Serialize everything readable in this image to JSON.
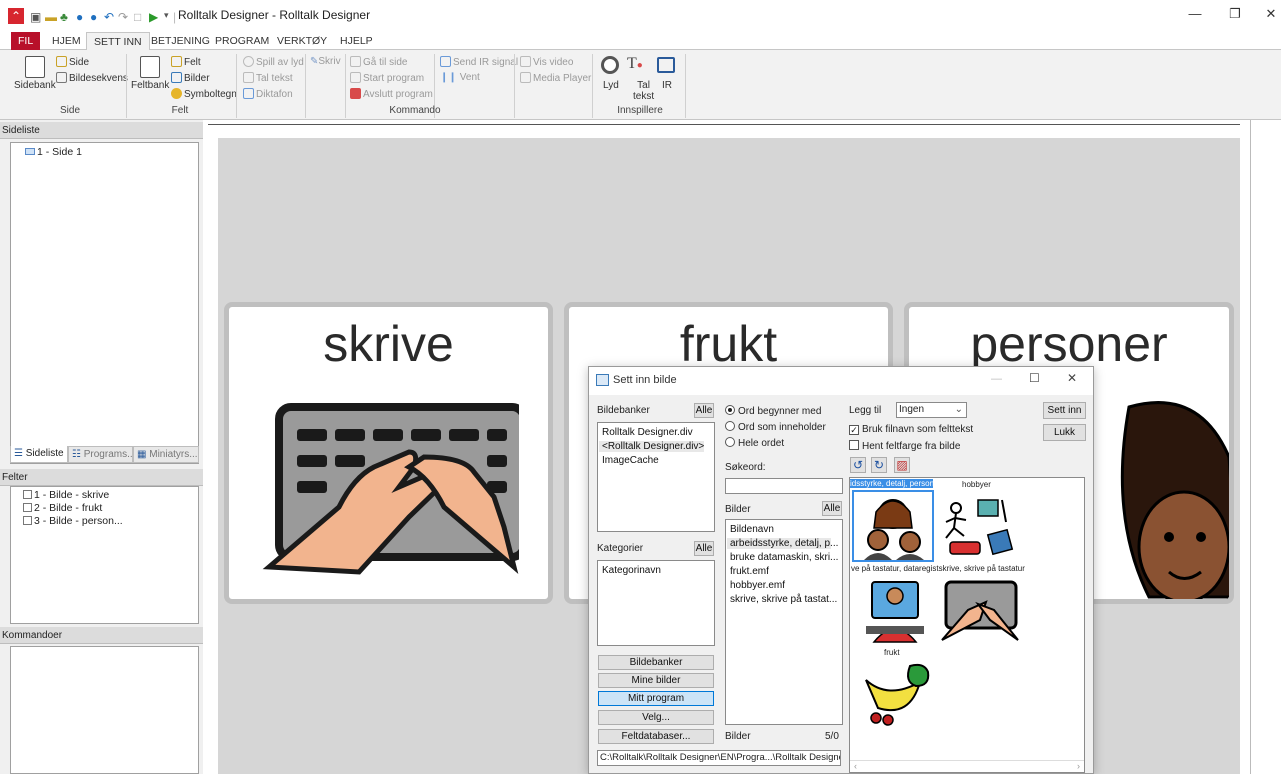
{
  "window": {
    "title": "Rolltalk Designer - Rolltalk Designer",
    "controls": {
      "minimize": "—",
      "restore": "❐",
      "close": "✕"
    }
  },
  "menu_tabs": [
    "FIL",
    "HJEM",
    "SETT INN",
    "BETJENING",
    "PROGRAM",
    "VERKTØY",
    "HJELP"
  ],
  "ribbon": {
    "side": {
      "sidebank": "Sidebank",
      "side": "Side",
      "bildesekvens": "Bildesekvens",
      "group": "Side"
    },
    "felt": {
      "feltbank": "Feltbank",
      "felt": "Felt",
      "bilder": "Bilder",
      "symboltegn": "Symboltegn",
      "group": "Felt"
    },
    "kommando": {
      "spill_av_lyd": "Spill av lyd",
      "tal_tekst": "Tal tekst",
      "diktafon": "Diktafon",
      "skriv": "Skriv",
      "ga_til_side": "Gå til side",
      "start_program": "Start program",
      "avslutt_program": "Avslutt program",
      "send_ir_signal": "Send IR signal",
      "vent": "Vent",
      "vis_video": "Vis video",
      "media_player": "Media Player",
      "group": "Kommando"
    },
    "innspillere": {
      "lyd": "Lyd",
      "tal_tekst_1": "Tal",
      "tal_tekst_2": "tekst",
      "ir": "IR",
      "group": "Innspillere"
    }
  },
  "left": {
    "sideliste_header": "Sideliste",
    "sideliste_items": [
      "1 - Side 1"
    ],
    "bottom_tabs": [
      "Sideliste",
      "Programs...",
      "Miniatyrs..."
    ],
    "felter_header": "Felter",
    "felter_items": [
      "1 - Bilde - skrive",
      "2 - Bilde - frukt",
      "3 - Bilde - person..."
    ],
    "kommandoer_header": "Kommandoer"
  },
  "cards": [
    {
      "word": "skrive",
      "icon": "keyboard-hands"
    },
    {
      "word": "frukt",
      "icon": "fruit"
    },
    {
      "word": "personer",
      "icon": "person"
    }
  ],
  "dialog": {
    "title": "Sett inn bilde",
    "bildebanker_label": "Bildebanker",
    "alle": "Alle",
    "bildebanker_items": [
      "Rolltalk Designer.div",
      "<Rolltalk Designer.div>",
      "ImageCache"
    ],
    "kategorier_label": "Kategorier",
    "kategorier_items": [
      "Kategorinavn"
    ],
    "side_buttons": [
      "Bildebanker",
      "Mine bilder",
      "Mitt program",
      "Velg...",
      "Feltdatabaser..."
    ],
    "search_modes": [
      "Ord begynner med",
      "Ord som inneholder",
      "Hele ordet"
    ],
    "sokeord_label": "Søkeord:",
    "sokeord_value": "",
    "bilder_label": "Bilder",
    "bilder_items": [
      "Bildenavn",
      "arbeidsstyrke, detalj, p...",
      "bruke datamaskin, skri...",
      "frukt.emf",
      "hobbyer.emf",
      "skrive, skrive på tastat..."
    ],
    "bilder_footer_label": "Bilder",
    "bilder_count": "5/0",
    "legg_til_label": "Legg til",
    "legg_til_value": "Ingen",
    "bruk_filnavn": "Bruk filnavn som felttekst",
    "hent_feltfarge": "Hent feltfarge fra bilde",
    "sett_inn": "Sett inn",
    "lukk": "Lukk",
    "path": "C:\\Rolltalk\\Rolltalk Designer\\EN\\Progra...\\Rolltalk Designer.div\\",
    "previews": [
      {
        "caption": "idsstyrke, detalj, person"
      },
      {
        "caption": "hobbyer"
      },
      {
        "caption": "ve på tastatur, dataregistskrive, skrive på tastatur"
      },
      {
        "caption": "frukt"
      }
    ]
  }
}
